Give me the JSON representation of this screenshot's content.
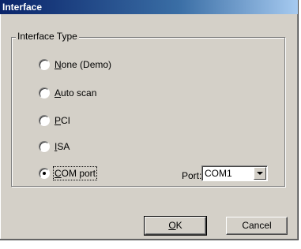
{
  "window": {
    "title": "Interface"
  },
  "group": {
    "title": "Interface Type",
    "options": [
      {
        "label": "None (Demo)",
        "mnemonic": "N",
        "rest": "one (Demo)",
        "selected": false
      },
      {
        "label": "Auto scan",
        "mnemonic": "A",
        "rest": "uto scan",
        "selected": false
      },
      {
        "label": "PCI",
        "mnemonic": "P",
        "rest": "CI",
        "selected": false
      },
      {
        "label": "ISA",
        "mnemonic": "I",
        "rest": "SA",
        "selected": false
      },
      {
        "label": "COM port",
        "mnemonic": "C",
        "rest": "OM port",
        "selected": true
      }
    ]
  },
  "port": {
    "label": "Port:",
    "value": "COM1"
  },
  "buttons": {
    "ok_mnemonic": "O",
    "ok_rest": "K",
    "cancel": "Cancel"
  }
}
